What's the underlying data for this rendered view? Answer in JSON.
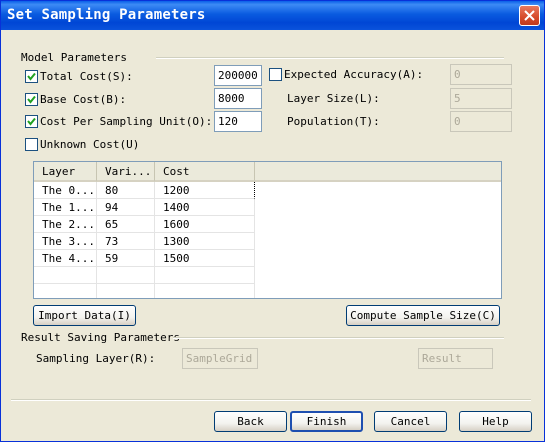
{
  "window": {
    "title": "Set Sampling Parameters"
  },
  "model_parameters": {
    "heading": "Model Parameters",
    "total_cost": {
      "label": "Total Cost(S):",
      "checked": true,
      "value": "200000"
    },
    "base_cost": {
      "label": "Base Cost(B):",
      "checked": true,
      "value": "8000"
    },
    "cost_per_unit": {
      "label": "Cost Per Sampling Unit(O):",
      "checked": true,
      "value": "120"
    },
    "unknown_cost": {
      "label": "Unknown Cost(U)",
      "checked": false
    },
    "expected_accuracy": {
      "label": "Expected Accuracy(A):",
      "checked": false,
      "value": "0"
    },
    "layer_size": {
      "label": "Layer Size(L):",
      "value": "5"
    },
    "population": {
      "label": "Population(T):",
      "value": "0"
    }
  },
  "table": {
    "columns": [
      "Layer",
      "Vari...",
      "Cost"
    ],
    "rows": [
      [
        "The 0...",
        "80",
        "1200"
      ],
      [
        "The 1...",
        "94",
        "1400"
      ],
      [
        "The 2...",
        "65",
        "1600"
      ],
      [
        "The 3...",
        "73",
        "1300"
      ],
      [
        "The 4...",
        "59",
        "1500"
      ]
    ]
  },
  "buttons": {
    "import_data": "Import Data(I)",
    "compute_sample_size": "Compute Sample Size(C)",
    "back": "Back",
    "finish": "Finish",
    "cancel": "Cancel",
    "help": "Help"
  },
  "result_saving": {
    "heading": "Result Saving Parameters",
    "sampling_layer_label": "Sampling Layer(R):",
    "sampling_layer_value": "SampleGrid",
    "result_value": "Result"
  },
  "colors": {
    "titlebar": "#0A5BE0",
    "dialog_bg": "#ECE9D8",
    "checkmark": "#21A121",
    "close_button": "#D64A2A"
  }
}
